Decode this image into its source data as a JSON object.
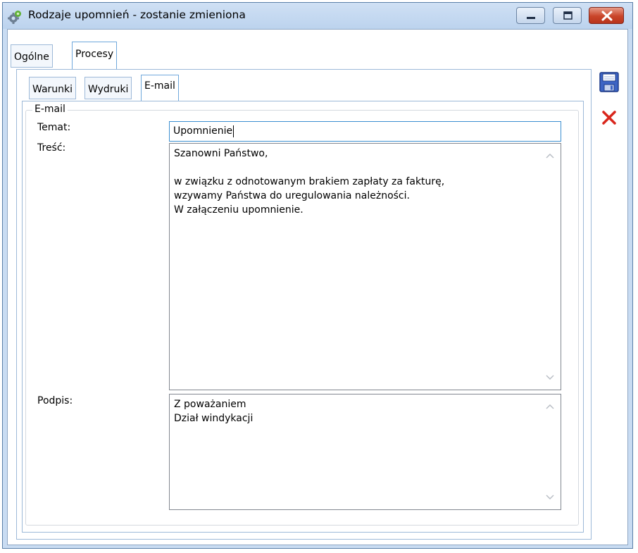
{
  "window": {
    "title": "Rodzaje upomnień - zostanie zmieniona",
    "app_icon": "gear-icon",
    "buttons": [
      "minimize-icon",
      "maximize-icon",
      "close-icon"
    ]
  },
  "outer_tabs": [
    {
      "label": "Ogólne",
      "active": false
    },
    {
      "label": "Procesy",
      "active": true
    }
  ],
  "inner_tabs": [
    {
      "label": "Warunki",
      "active": false
    },
    {
      "label": "Wydruki",
      "active": false
    },
    {
      "label": "E-mail",
      "active": true
    }
  ],
  "email": {
    "group_label": "E-mail",
    "subject_label": "Temat:",
    "subject_value": "Upomnienie",
    "body_label": "Treść:",
    "body_value": "Szanowni Państwo,\n\nw związku z odnotowanym brakiem zapłaty za fakturę,\nwzywamy Państwa do uregulowania należności.\nW załączeniu upomnienie.",
    "signature_label": "Podpis:",
    "signature_value": "Z poważaniem\nDział windykacji"
  },
  "side_toolbar": [
    {
      "icon": "save-icon"
    },
    {
      "icon": "cancel-icon"
    }
  ],
  "colors": {
    "frame": "#c9dcf2",
    "close_button": "#c9452a",
    "active_field_border": "#3c8fd1",
    "cancel_icon": "#d9261c"
  }
}
